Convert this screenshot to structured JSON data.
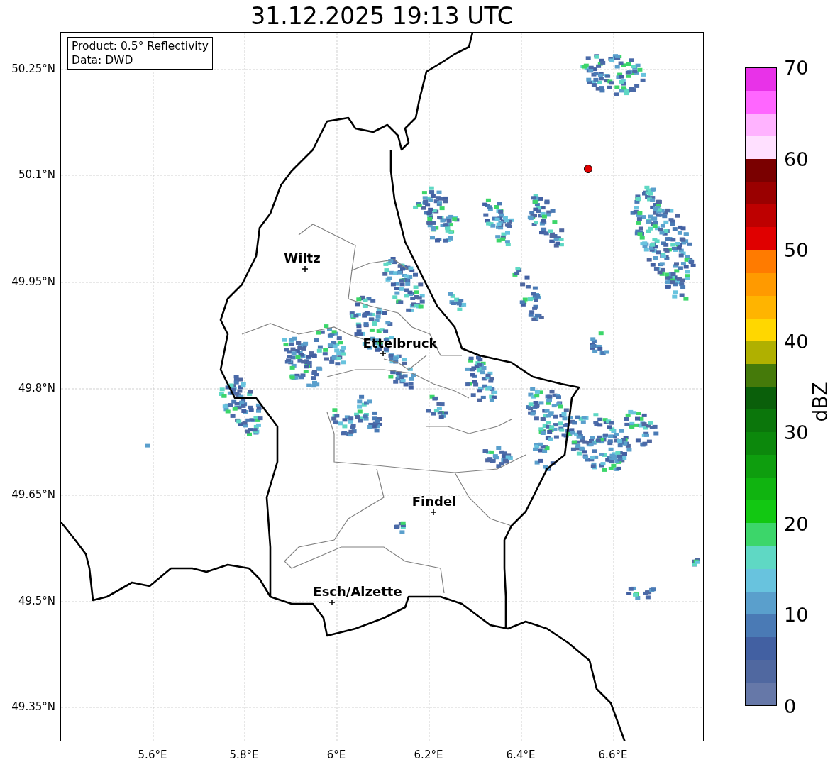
{
  "title": "31.12.2025 19:13 UTC",
  "info_box": {
    "lines": [
      "Product: 0.5° Reflectivity",
      "Data: DWD"
    ]
  },
  "lat_ticks": [
    "50.25°N",
    "50.1°N",
    "49.95°N",
    "49.8°N",
    "49.65°N",
    "49.5°N",
    "49.35°N"
  ],
  "lon_ticks": [
    "5.6°E",
    "5.8°E",
    "6°E",
    "6.2°E",
    "6.4°E",
    "6.6°E"
  ],
  "cities": [
    {
      "name": "Wiltz"
    },
    {
      "name": "Ettelbruck"
    },
    {
      "name": "Findel"
    },
    {
      "name": "Esch/Alzette"
    }
  ],
  "colorbar": {
    "label": "dBZ",
    "ticks": [
      "70",
      "60",
      "50",
      "40",
      "30",
      "20",
      "10",
      "0"
    ],
    "bins": [
      {
        "color": "#6678a8"
      },
      {
        "color": "#5068a0"
      },
      {
        "color": "#4260a2"
      },
      {
        "color": "#4a7ab5"
      },
      {
        "color": "#5a9fcc"
      },
      {
        "color": "#68c3de"
      },
      {
        "color": "#5fd8c4"
      },
      {
        "color": "#3cd66a"
      },
      {
        "color": "#12c812"
      },
      {
        "color": "#10b410"
      },
      {
        "color": "#0e9e0e"
      },
      {
        "color": "#0c880c"
      },
      {
        "color": "#0b760b"
      },
      {
        "color": "#0a5f0a"
      },
      {
        "color": "#457a0a"
      },
      {
        "color": "#b0b000"
      },
      {
        "color": "#ffd700"
      },
      {
        "color": "#ffb400"
      },
      {
        "color": "#ff9a00"
      },
      {
        "color": "#ff7b00"
      },
      {
        "color": "#e00000"
      },
      {
        "color": "#be0000"
      },
      {
        "color": "#9a0000"
      },
      {
        "color": "#7a0000"
      },
      {
        "color": "#ffe0ff"
      },
      {
        "color": "#ffb3ff"
      },
      {
        "color": "#ff66ff"
      },
      {
        "color": "#e832e8"
      }
    ]
  }
}
